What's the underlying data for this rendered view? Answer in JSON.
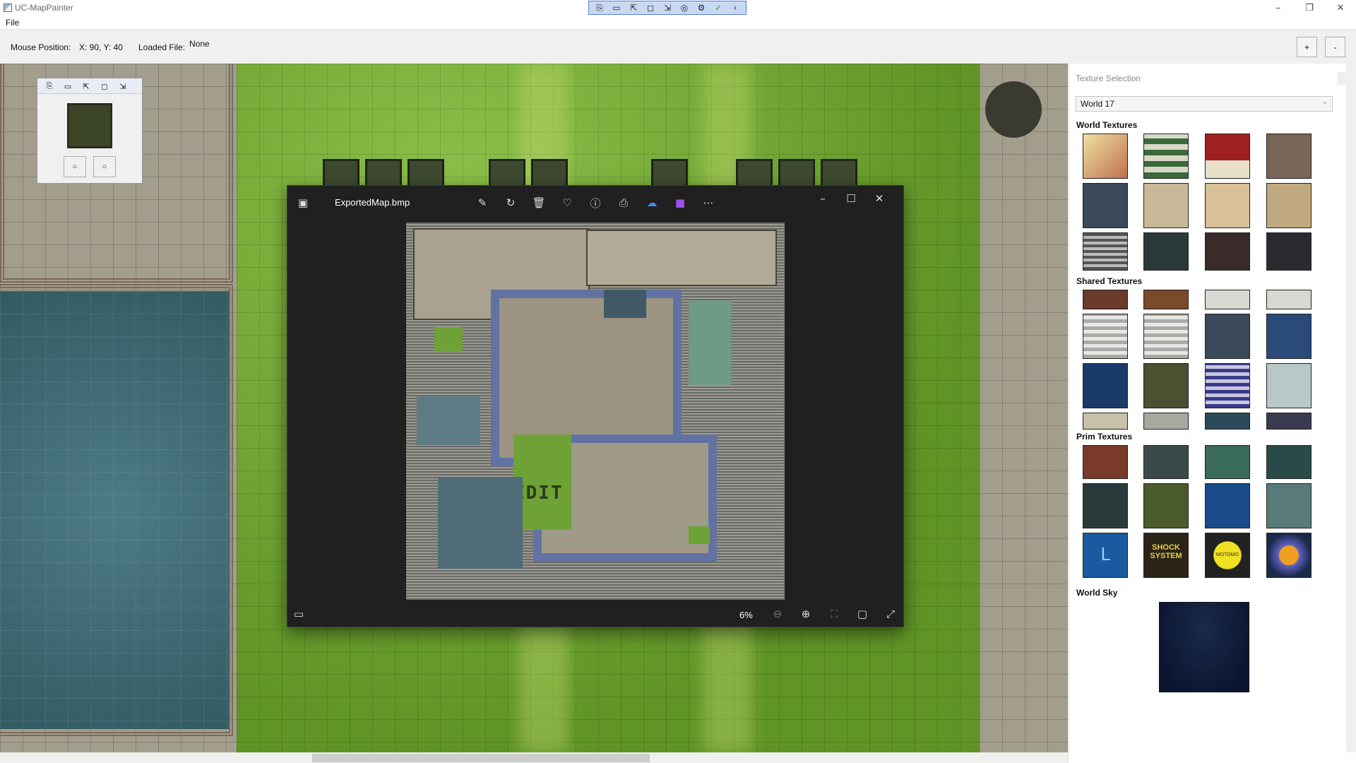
{
  "window": {
    "title": "UC-MapPainter",
    "minimize": "–",
    "maximize": "❐",
    "close": "✕"
  },
  "toolbar": {
    "tools": [
      "⎘",
      "▭",
      "⇱",
      "◻",
      "⇲",
      "◎",
      "⚙",
      "✓",
      "‹"
    ]
  },
  "menu": {
    "file": "File"
  },
  "status": {
    "mouse_label": "Mouse Position:",
    "mouse_value": "X: 90, Y: 40",
    "loaded_label": "Loaded File:",
    "loaded_value": "None",
    "zoom_in": "+",
    "zoom_out": "-"
  },
  "mini_toolbar": {
    "tools": [
      "⎘",
      "▭",
      "⇱",
      "◻",
      "⇲"
    ],
    "btn_a": "○",
    "btn_b": "○"
  },
  "photo_viewer": {
    "filename": "ExportedMap.bmp",
    "zoom": "6%",
    "image_label": "EDIT",
    "icons": [
      "edit-icon",
      "rotate-icon",
      "delete-icon",
      "heart-icon",
      "info-icon",
      "print-icon",
      "onedrive-icon",
      "clipchamp-icon",
      "more-icon"
    ]
  },
  "texture_panel": {
    "header": "Texture Selection",
    "world_select": "World 17",
    "sections": {
      "world": "World Textures",
      "shared": "Shared Textures",
      "prim": "Prim Textures",
      "sky": "World Sky"
    },
    "prim_labels": {
      "t9": "SHOCK SYSTEM",
      "t10": "MOTOMO"
    }
  },
  "colors": {
    "accent": "#5b7fcc",
    "grass": "#6a9c2c",
    "water": "#3c6872",
    "viewer_bg": "#202020"
  }
}
